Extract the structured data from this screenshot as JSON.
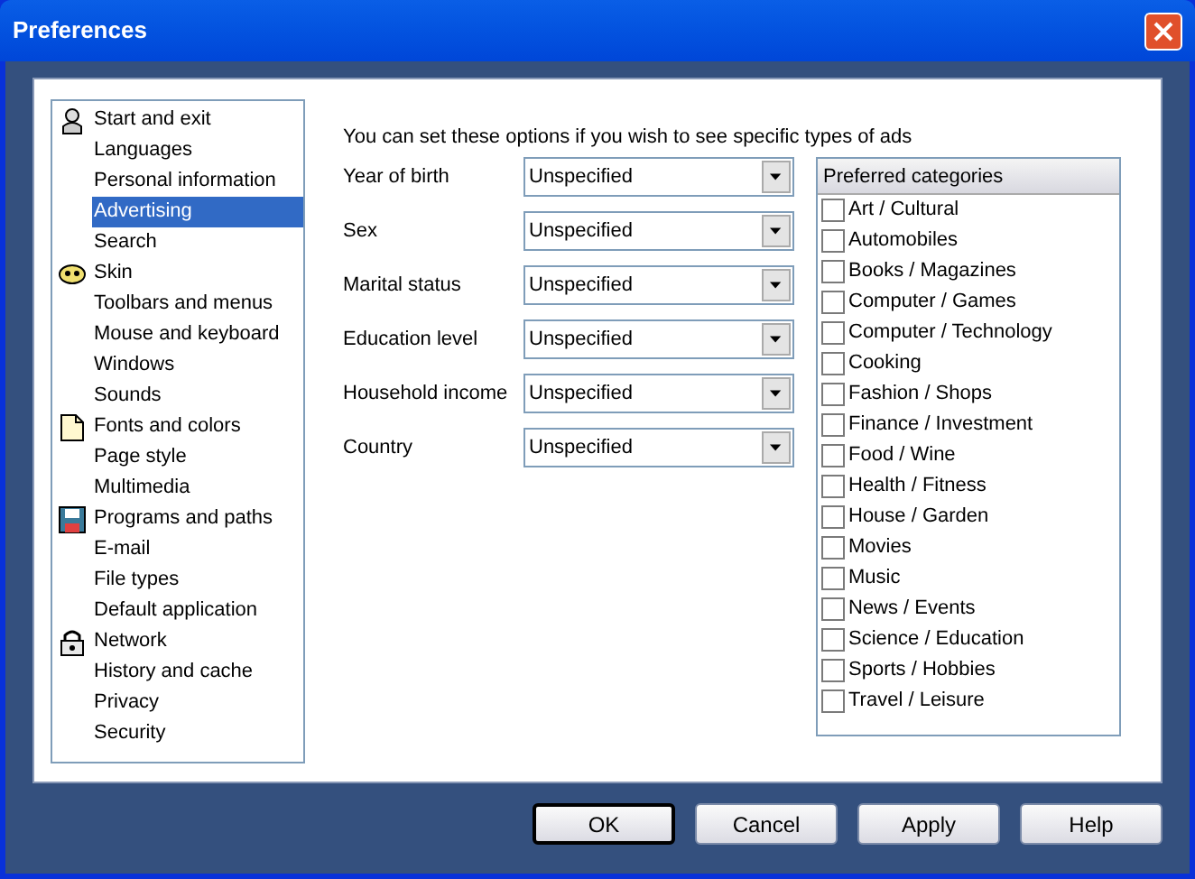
{
  "window": {
    "title": "Preferences"
  },
  "sidebar": {
    "groups": [
      {
        "label": "Start and exit",
        "selected": false,
        "children": [
          {
            "label": "Languages",
            "selected": false
          },
          {
            "label": "Personal information",
            "selected": false
          },
          {
            "label": "Advertising",
            "selected": true
          },
          {
            "label": "Search",
            "selected": false
          }
        ]
      },
      {
        "label": "Skin",
        "selected": false,
        "children": [
          {
            "label": "Toolbars and menus",
            "selected": false
          },
          {
            "label": "Mouse and keyboard",
            "selected": false
          },
          {
            "label": "Windows",
            "selected": false
          },
          {
            "label": "Sounds",
            "selected": false
          }
        ]
      },
      {
        "label": "Fonts and colors",
        "selected": false,
        "children": [
          {
            "label": "Page style",
            "selected": false
          },
          {
            "label": "Multimedia",
            "selected": false
          }
        ]
      },
      {
        "label": "Programs and paths",
        "selected": false,
        "children": [
          {
            "label": "E-mail",
            "selected": false
          },
          {
            "label": "File types",
            "selected": false
          },
          {
            "label": "Default application",
            "selected": false
          }
        ]
      },
      {
        "label": "Network",
        "selected": false,
        "children": [
          {
            "label": "History and cache",
            "selected": false
          },
          {
            "label": "Privacy",
            "selected": false
          },
          {
            "label": "Security",
            "selected": false
          }
        ]
      }
    ]
  },
  "intro": "You can set these options if you wish to see specific types of ads",
  "fields": [
    {
      "label": "Year of birth",
      "value": "Unspecified"
    },
    {
      "label": "Sex",
      "value": "Unspecified"
    },
    {
      "label": "Marital status",
      "value": "Unspecified"
    },
    {
      "label": "Education level",
      "value": "Unspecified"
    },
    {
      "label": "Household income",
      "value": "Unspecified"
    },
    {
      "label": "Country",
      "value": "Unspecified"
    }
  ],
  "categories": {
    "header": "Preferred categories",
    "items": [
      {
        "label": "Art / Cultural",
        "checked": false
      },
      {
        "label": "Automobiles",
        "checked": false
      },
      {
        "label": "Books / Magazines",
        "checked": false
      },
      {
        "label": "Computer / Games",
        "checked": false
      },
      {
        "label": "Computer / Technology",
        "checked": false
      },
      {
        "label": "Cooking",
        "checked": false
      },
      {
        "label": "Fashion / Shops",
        "checked": false
      },
      {
        "label": "Finance / Investment",
        "checked": false
      },
      {
        "label": "Food / Wine",
        "checked": false
      },
      {
        "label": "Health / Fitness",
        "checked": false
      },
      {
        "label": "House / Garden",
        "checked": false
      },
      {
        "label": "Movies",
        "checked": false
      },
      {
        "label": "Music",
        "checked": false
      },
      {
        "label": "News / Events",
        "checked": false
      },
      {
        "label": "Science / Education",
        "checked": false
      },
      {
        "label": "Sports / Hobbies",
        "checked": false
      },
      {
        "label": "Travel / Leisure",
        "checked": false
      }
    ]
  },
  "buttons": [
    {
      "label": "OK",
      "default": true
    },
    {
      "label": "Cancel",
      "default": false
    },
    {
      "label": "Apply",
      "default": false
    },
    {
      "label": "Help",
      "default": false
    }
  ]
}
